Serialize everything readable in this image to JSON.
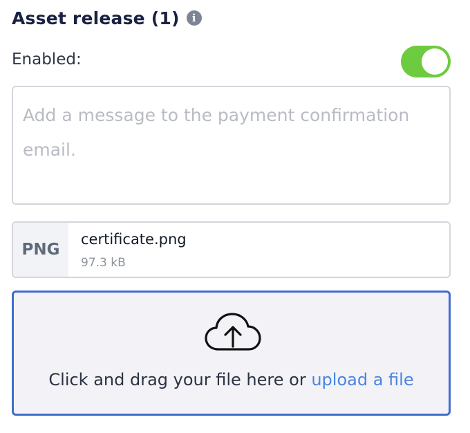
{
  "section": {
    "title": "Asset release (1)",
    "info_icon": "info-icon"
  },
  "enabled": {
    "label": "Enabled:",
    "value": true,
    "toggle_color": "#6dcb3f"
  },
  "message": {
    "value": "",
    "placeholder": "Add a message to the payment confirmation email."
  },
  "file": {
    "type": "PNG",
    "name": "certificate.png",
    "size": "97.3 kB"
  },
  "dropzone": {
    "icon": "cloud-upload-icon",
    "text": "Click and drag your file here or",
    "link": "upload a file",
    "border_color": "#3f6ccb",
    "link_color": "#4a84e0"
  }
}
